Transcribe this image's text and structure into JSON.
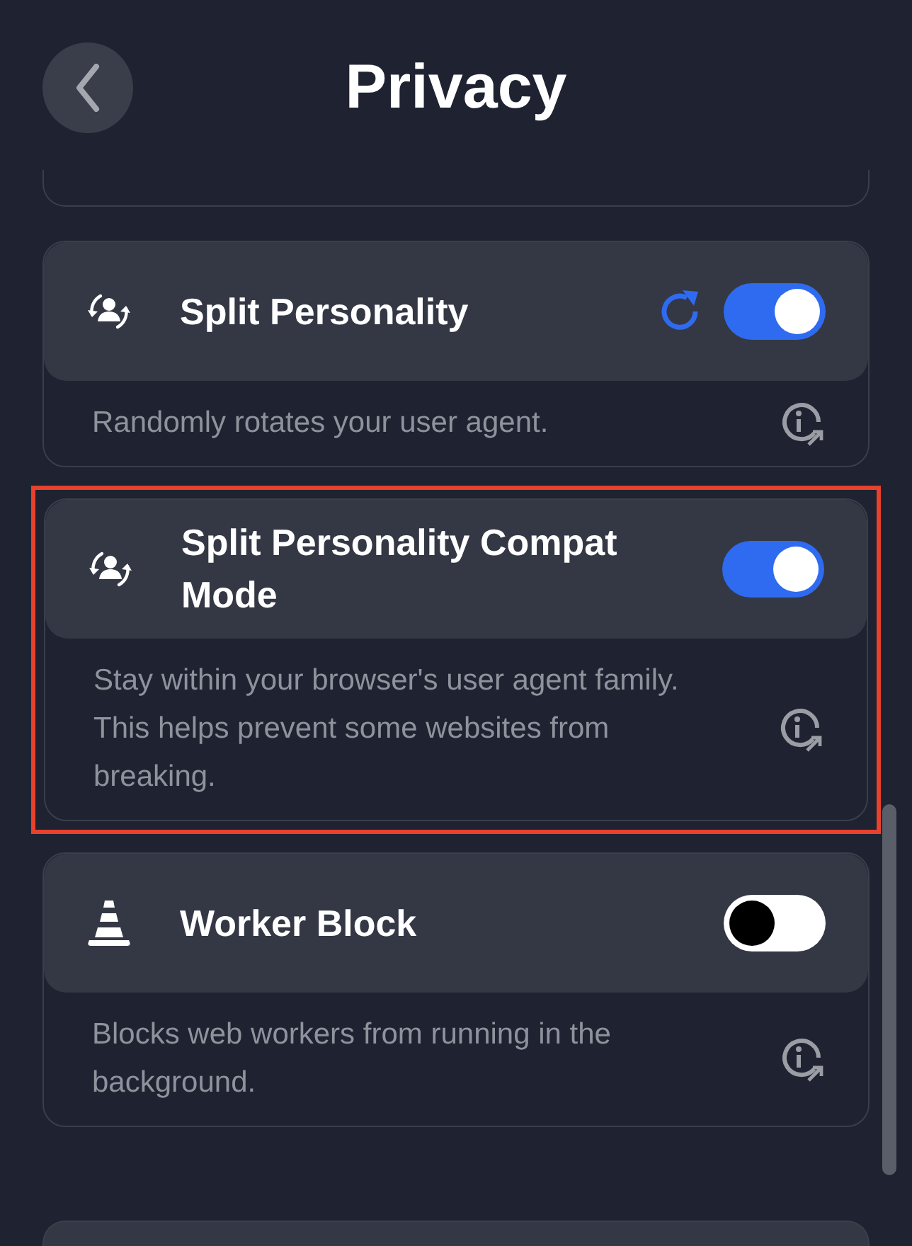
{
  "header": {
    "title": "Privacy"
  },
  "settings": [
    {
      "kind": "persona",
      "title": "Split Personality",
      "description": "Randomly rotates your user agent.",
      "refresh": true,
      "on": true,
      "highlighted": false
    },
    {
      "kind": "persona",
      "title": "Split Personality Compat Mode",
      "description": "Stay within your browser's user agent family. This helps prevent some websites from breaking.",
      "refresh": false,
      "on": true,
      "highlighted": true
    },
    {
      "kind": "cone",
      "title": "Worker Block",
      "description": "Blocks web workers from running in the background.",
      "refresh": false,
      "on": false,
      "highlighted": false
    }
  ]
}
